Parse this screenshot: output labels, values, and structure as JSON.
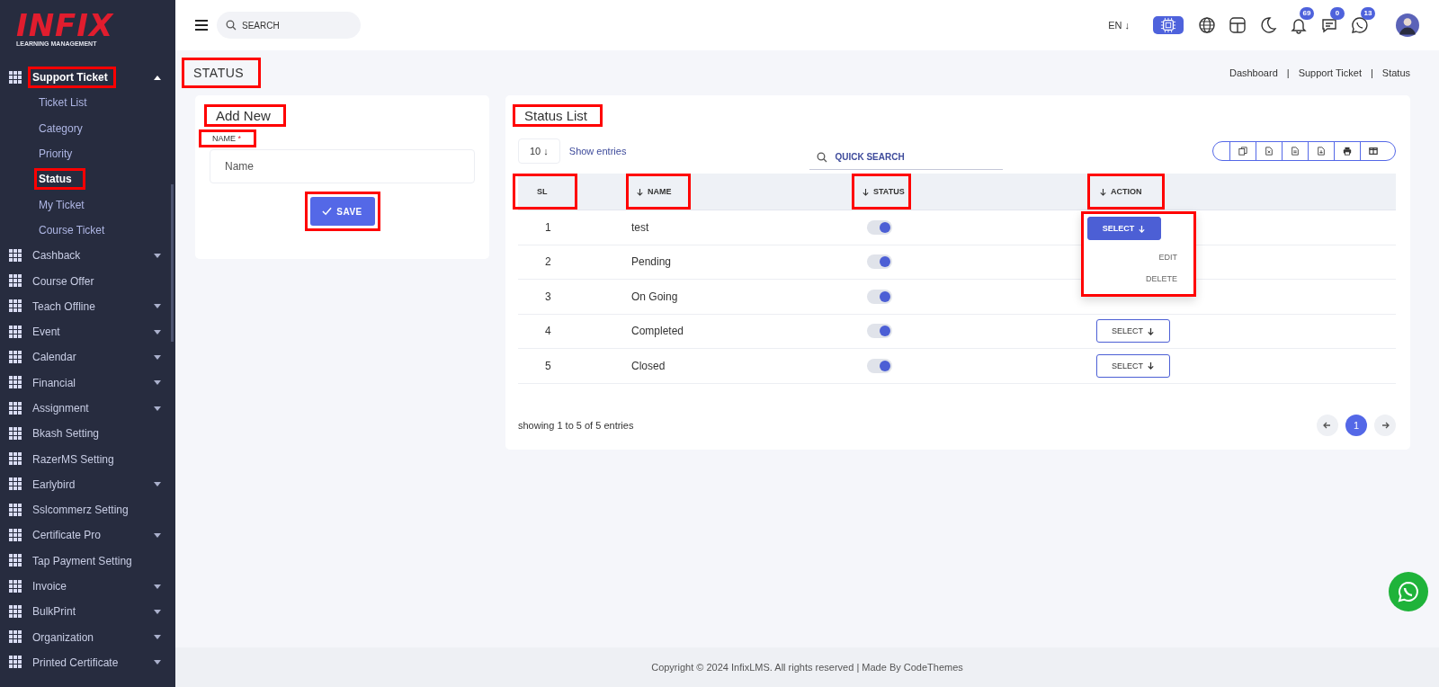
{
  "sidebar": {
    "logo": {
      "title": "INFIX",
      "subtitle": "LEARNING MANAGEMENT"
    },
    "items": [
      {
        "label": "Support Ticket",
        "has_children": true,
        "expanded": true,
        "annotated": true,
        "children": [
          {
            "label": "Ticket List",
            "selected": false,
            "annotated": false
          },
          {
            "label": "Category",
            "selected": false,
            "annotated": false
          },
          {
            "label": "Priority",
            "selected": false,
            "annotated": false
          },
          {
            "label": "Status",
            "selected": true,
            "annotated": true
          },
          {
            "label": "My Ticket",
            "selected": false,
            "annotated": false
          },
          {
            "label": "Course Ticket",
            "selected": false,
            "annotated": false
          }
        ]
      },
      {
        "label": "Cashback",
        "has_children": true,
        "expanded": false,
        "annotated": false
      },
      {
        "label": "Course Offer",
        "has_children": false,
        "expanded": false,
        "annotated": false
      },
      {
        "label": "Teach Offline",
        "has_children": true,
        "expanded": false,
        "annotated": false
      },
      {
        "label": "Event",
        "has_children": true,
        "expanded": false,
        "annotated": false
      },
      {
        "label": "Calendar",
        "has_children": true,
        "expanded": false,
        "annotated": false
      },
      {
        "label": "Financial",
        "has_children": true,
        "expanded": false,
        "annotated": false
      },
      {
        "label": "Assignment",
        "has_children": true,
        "expanded": false,
        "annotated": false
      },
      {
        "label": "Bkash Setting",
        "has_children": false,
        "expanded": false,
        "annotated": false
      },
      {
        "label": "RazerMS Setting",
        "has_children": false,
        "expanded": false,
        "annotated": false
      },
      {
        "label": "Earlybird",
        "has_children": true,
        "expanded": false,
        "annotated": false
      },
      {
        "label": "Sslcommerz Setting",
        "has_children": false,
        "expanded": false,
        "annotated": false
      },
      {
        "label": "Certificate Pro",
        "has_children": true,
        "expanded": false,
        "annotated": false
      },
      {
        "label": "Tap Payment Setting",
        "has_children": false,
        "expanded": false,
        "annotated": false
      },
      {
        "label": "Invoice",
        "has_children": true,
        "expanded": false,
        "annotated": false
      },
      {
        "label": "BulkPrint",
        "has_children": true,
        "expanded": false,
        "annotated": false
      },
      {
        "label": "Organization",
        "has_children": true,
        "expanded": false,
        "annotated": false
      },
      {
        "label": "Printed Certificate",
        "has_children": true,
        "expanded": false,
        "annotated": false
      }
    ]
  },
  "header": {
    "search": {
      "placeholder": "SEARCH"
    },
    "language": {
      "label": "EN",
      "arrow": "↓"
    },
    "tools": [
      {
        "kind": "ai"
      },
      {
        "kind": "globe"
      },
      {
        "kind": "layout"
      },
      {
        "kind": "moon"
      }
    ],
    "notifications": [
      {
        "kind": "bell",
        "count": "69"
      },
      {
        "kind": "chat",
        "count": "0"
      },
      {
        "kind": "whatsapp",
        "count": "13"
      }
    ]
  },
  "page": {
    "title": "STATUS",
    "title_annotated": true,
    "separator": "|",
    "breadcrumbs": [
      {
        "label": "Dashboard"
      },
      {
        "label": "Support Ticket"
      },
      {
        "label": "Status"
      }
    ]
  },
  "add_new": {
    "title": "Add New",
    "title_annotated": true,
    "field": {
      "label": "NAME",
      "required_mark": "*",
      "placeholder": "Name",
      "label_annotated": true
    },
    "save_button": {
      "label": "SAVE",
      "annotated": true
    }
  },
  "status_list": {
    "title": "Status List",
    "title_annotated": true,
    "page_size": "10",
    "page_size_arrow": "↓",
    "show_entries": "Show entries",
    "search_placeholder": "QUICK SEARCH",
    "export_buttons": [
      {
        "kind": "copy"
      },
      {
        "kind": "excel"
      },
      {
        "kind": "csv"
      },
      {
        "kind": "pdf"
      },
      {
        "kind": "print"
      },
      {
        "kind": "columns"
      }
    ],
    "columns": [
      {
        "label": "SL",
        "sortable": false,
        "annotated": true
      },
      {
        "label": "NAME",
        "sortable": true,
        "annotated": true
      },
      {
        "label": "STATUS",
        "sortable": true,
        "annotated": true
      },
      {
        "label": "ACTION",
        "sortable": true,
        "annotated": true
      }
    ],
    "rows": [
      {
        "sl": "1",
        "name": "test",
        "active": true,
        "action": "SELECT",
        "menu_open": true
      },
      {
        "sl": "2",
        "name": "Pending",
        "active": true,
        "menu_open": false
      },
      {
        "sl": "3",
        "name": "On Going",
        "active": true,
        "menu_open": false
      },
      {
        "sl": "4",
        "name": "Completed",
        "active": true,
        "action": "SELECT",
        "menu_open": false
      },
      {
        "sl": "5",
        "name": "Closed",
        "active": true,
        "action": "SELECT",
        "menu_open": false
      }
    ],
    "menu": {
      "items": [
        "EDIT",
        "DELETE"
      ],
      "annotated": true
    },
    "summary": "showing 1 to 5 of 5 entries",
    "pages": [
      {
        "label": "1",
        "selected": true
      }
    ]
  },
  "footer": {
    "copyright": "Copyright © 2024 InfixLMS. All rights reserved | Made By CodeThemes"
  }
}
